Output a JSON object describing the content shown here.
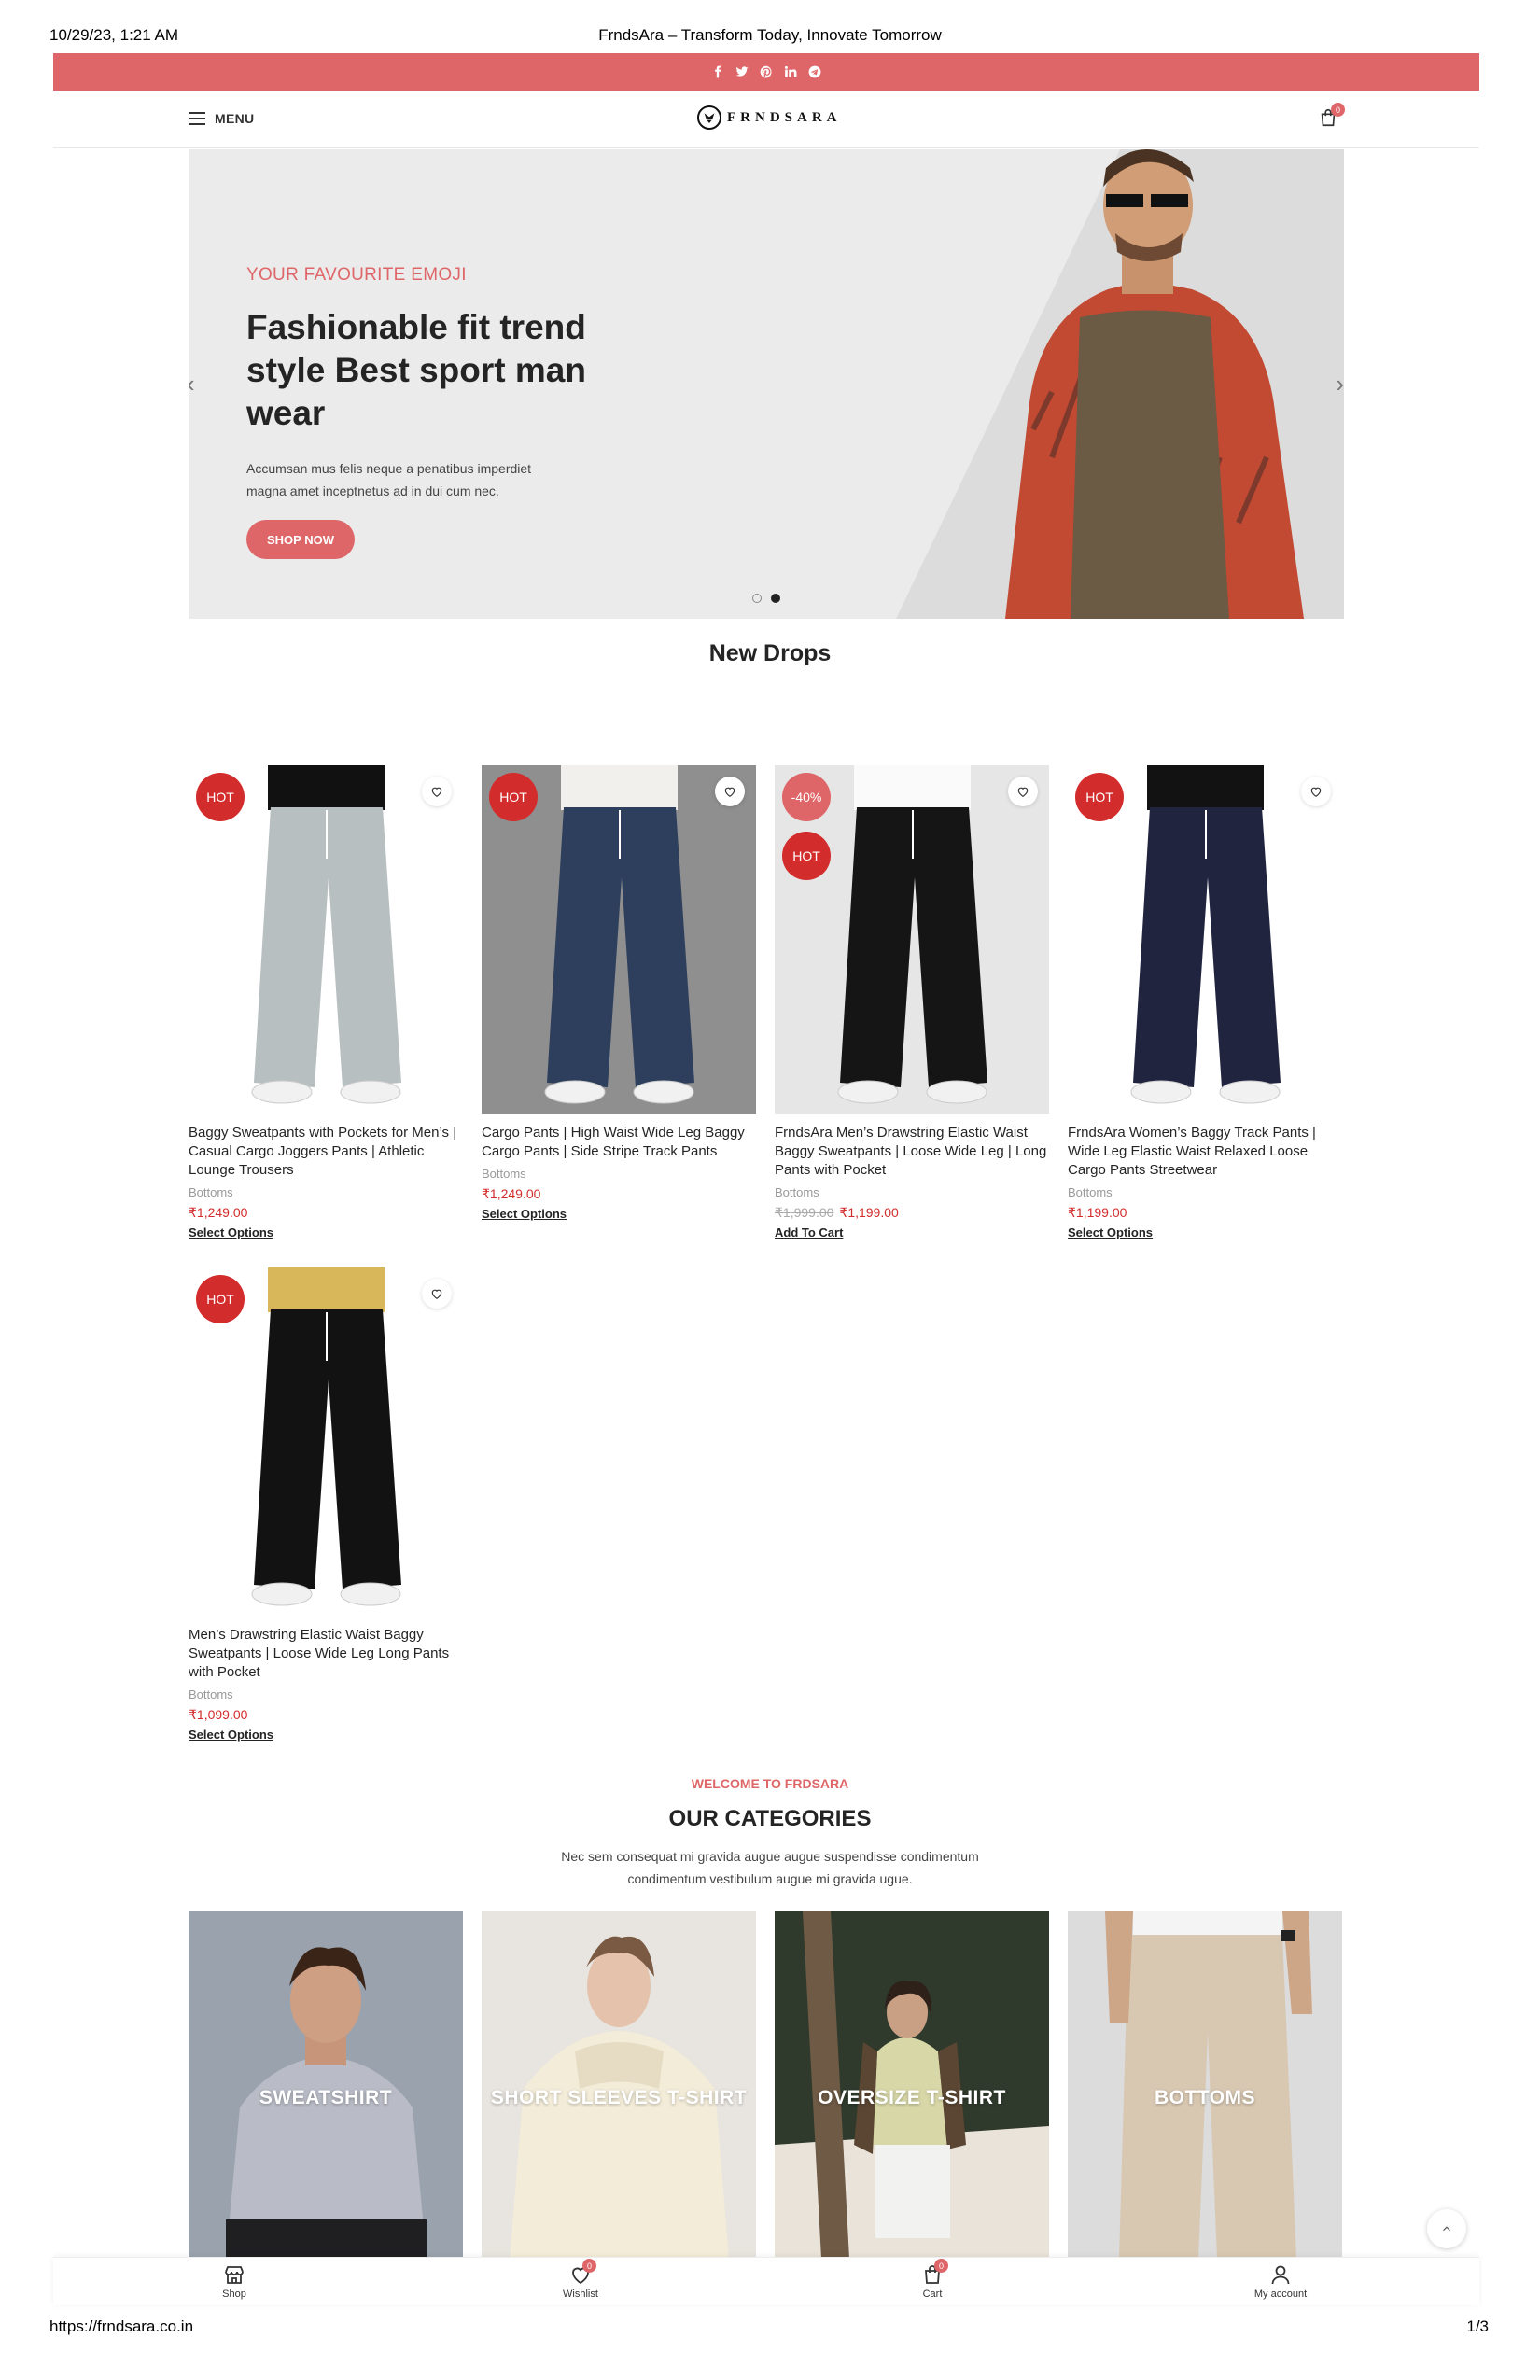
{
  "print": {
    "date": "10/29/23, 1:21 AM",
    "title": "FrndsAra – Transform Today, Innovate Tomorrow",
    "url": "https://frndsara.co.in",
    "page": "1/3"
  },
  "social_icons": [
    "facebook-icon",
    "twitter-icon",
    "pinterest-icon",
    "linkedin-icon",
    "telegram-icon"
  ],
  "header": {
    "menu_label": "MENU",
    "logo_text": "FRNDSARA",
    "cart_count": "0"
  },
  "hero": {
    "eyebrow": "YOUR FAVOURITE EMOJI",
    "title": "Fashionable fit trend style Best sport man wear",
    "text": "Accumsan mus felis neque a penatibus imperdiet magna amet inceptnetus ad in dui cum nec.",
    "button": "SHOP NOW",
    "prev": "‹",
    "next": "›",
    "active_slide": 2
  },
  "new_drops": {
    "title": "New Drops",
    "products": [
      {
        "name": "Baggy Sweatpants with Pockets for Men’s | Casual Cargo Joggers Pants | Athletic Lounge Trousers",
        "category": "Bottoms",
        "price": "₹1,249.00",
        "old_price": "",
        "tags": [
          "HOT"
        ],
        "action": "Select Options"
      },
      {
        "name": "Cargo Pants | High Waist Wide Leg Baggy Cargo Pants | Side Stripe Track Pants",
        "category": "Bottoms",
        "price": "₹1,249.00",
        "old_price": "",
        "tags": [
          "HOT"
        ],
        "action": "Select Options"
      },
      {
        "name": "FrndsAra Men’s Drawstring Elastic Waist Baggy Sweatpants | Loose Wide Leg | Long Pants with Pocket",
        "category": "Bottoms",
        "price": "₹1,199.00",
        "old_price": "₹1,999.00",
        "tags": [
          "-40%",
          "HOT"
        ],
        "action": "Add To Cart"
      },
      {
        "name": "FrndsAra Women’s Baggy Track Pants | Wide Leg Elastic Waist Relaxed Loose Cargo Pants Streetwear",
        "category": "Bottoms",
        "price": "₹1,199.00",
        "old_price": "",
        "tags": [
          "HOT"
        ],
        "action": "Select Options"
      },
      {
        "name": "Men’s Drawstring Elastic Waist Baggy Sweatpants | Loose Wide Leg Long Pants with Pocket",
        "category": "Bottoms",
        "price": "₹1,099.00",
        "old_price": "",
        "tags": [
          "HOT"
        ],
        "action": "Select Options"
      }
    ]
  },
  "categories": {
    "welcome": "WELCOME TO FRDSARA",
    "title": "OUR CATEGORIES",
    "text": "Nec sem consequat mi gravida augue augue suspendisse condimentum condimentum vestibulum augue mi gravida ugue.",
    "items": [
      {
        "label": "SWEATSHIRT",
        "bg": "#9aa3ad"
      },
      {
        "label": "SHORT SLEEVES T-SHIRT",
        "bg": "#e8e4df"
      },
      {
        "label": "OVERSIZE T-SHIRT",
        "bg": "#2f3a2c"
      },
      {
        "label": "BOTTOMS",
        "bg": "#dcdcdc"
      }
    ]
  },
  "bottom_bar": {
    "shop": "Shop",
    "wishlist": "Wishlist",
    "wishlist_count": "0",
    "cart": "Cart",
    "cart_count": "0",
    "account": "My account"
  },
  "colors": {
    "accent": "#df6668",
    "hot": "#d32c2c",
    "text": "#242424"
  }
}
